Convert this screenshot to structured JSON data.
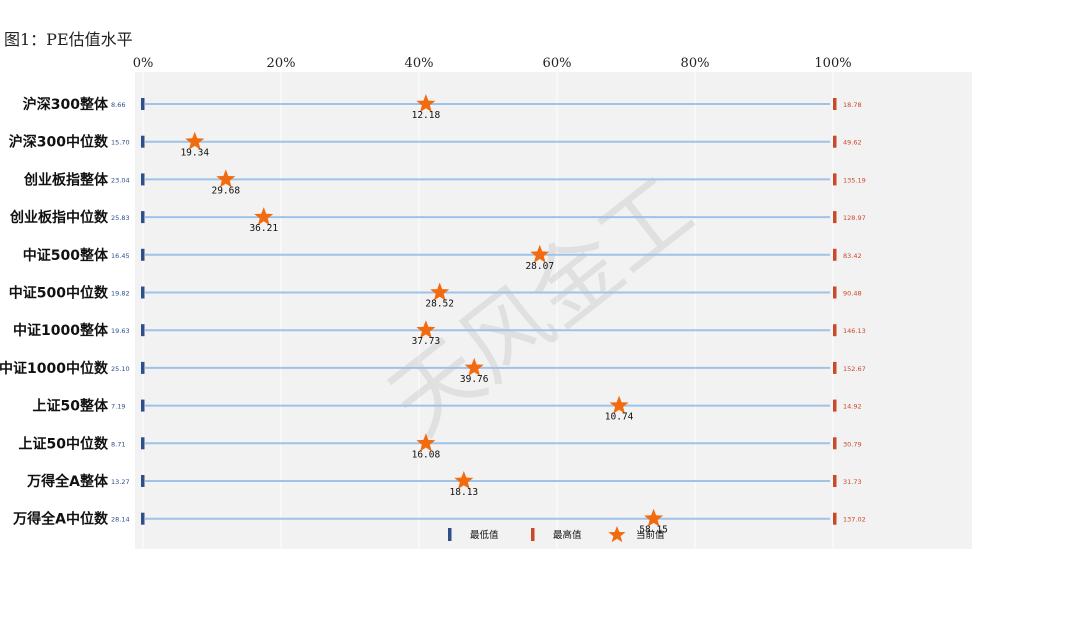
{
  "figure_title": "图1：PE估值水平",
  "watermark": "天风金工",
  "colors": {
    "min_marker": "#2f4f8a",
    "max_marker": "#c9492a",
    "current_star": "#f26b0f",
    "range_line": "#9fc3e7",
    "plot_bg": "#f2f2f2"
  },
  "chart_data": {
    "type": "dot-range",
    "title": "",
    "x_axis": {
      "min": 0,
      "max": 100,
      "ticks": [
        0,
        20,
        40,
        60,
        80,
        100
      ],
      "tick_labels": [
        "0%",
        "20%",
        "40%",
        "60%",
        "80%",
        "100%"
      ]
    },
    "legend": {
      "position": "bottom-center",
      "items": [
        {
          "key": "min",
          "label": "最低值",
          "icon": "blue-bar-icon"
        },
        {
          "key": "max",
          "label": "最高值",
          "icon": "red-bar-icon"
        },
        {
          "key": "current",
          "label": "当前值",
          "icon": "orange-star-icon"
        }
      ]
    },
    "rows": [
      {
        "name": "沪深300整体",
        "min": "8.66",
        "max": "18.78",
        "current": "12.18",
        "percentile": 41
      },
      {
        "name": "沪深300中位数",
        "min": "15.70",
        "max": "49.62",
        "current": "19.34",
        "percentile": 7.5
      },
      {
        "name": "创业板指整体",
        "min": "23.04",
        "max": "135.19",
        "current": "29.68",
        "percentile": 12
      },
      {
        "name": "创业板指中位数",
        "min": "25.83",
        "max": "128.97",
        "current": "36.21",
        "percentile": 17.5
      },
      {
        "name": "中证500整体",
        "min": "16.45",
        "max": "83.42",
        "current": "28.07",
        "percentile": 57.5
      },
      {
        "name": "中证500中位数",
        "min": "19.82",
        "max": "90.48",
        "current": "28.52",
        "percentile": 43
      },
      {
        "name": "中证1000整体",
        "min": "19.63",
        "max": "146.13",
        "current": "37.73",
        "percentile": 41
      },
      {
        "name": "中证1000中位数",
        "min": "25.10",
        "max": "152.67",
        "current": "39.76",
        "percentile": 48
      },
      {
        "name": "上证50整体",
        "min": "7.19",
        "max": "14.92",
        "current": "10.74",
        "percentile": 69
      },
      {
        "name": "上证50中位数",
        "min": "8.71",
        "max": "30.79",
        "current": "16.08",
        "percentile": 41
      },
      {
        "name": "万得全A整体",
        "min": "13.27",
        "max": "31.73",
        "current": "18.13",
        "percentile": 46.5
      },
      {
        "name": "万得全A中位数",
        "min": "28.14",
        "max": "137.02",
        "current": "58.15",
        "percentile": 74
      }
    ]
  }
}
